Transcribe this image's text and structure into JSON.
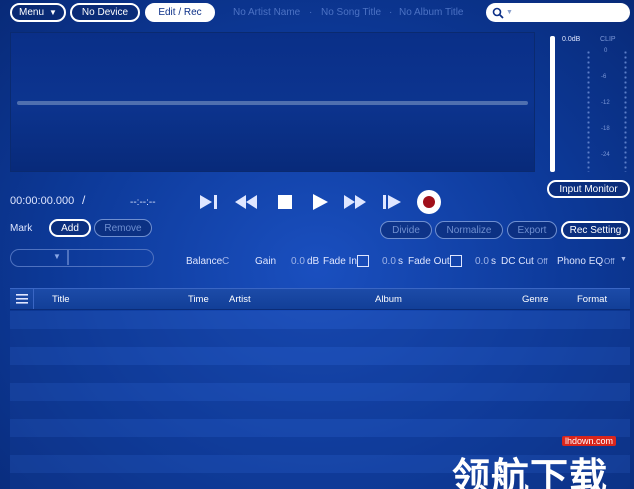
{
  "toolbar": {
    "menu_label": "Menu",
    "device_label": "No Device",
    "edit_rec_label": "Edit / Rec",
    "artist_placeholder": "No Artist Name",
    "song_placeholder": "No Song Title",
    "album_placeholder": "No Album Title"
  },
  "meter": {
    "db_label": "0.0dB",
    "clip_label": "CLIP",
    "scale": [
      "0",
      "-6",
      "-12",
      "-18",
      "-24"
    ],
    "input_monitor_label": "Input Monitor"
  },
  "time": {
    "position": "00:00:00.000",
    "separator": "/",
    "length": "--:--:--"
  },
  "mark": {
    "label": "Mark",
    "add_label": "Add",
    "remove_label": "Remove"
  },
  "actions": {
    "divide_label": "Divide",
    "normalize_label": "Normalize",
    "export_label": "Export",
    "rec_setting_label": "Rec Setting"
  },
  "controls": {
    "balance_label": "Balance",
    "balance_value": "C",
    "gain_label": "Gain",
    "gain_value": "0.0",
    "gain_unit": "dB",
    "fade_in_label": "Fade In",
    "fade_in_value": "0.0",
    "fade_in_unit": "s",
    "fade_out_label": "Fade Out",
    "fade_out_value": "0.0",
    "fade_out_unit": "s",
    "dc_cut_label": "DC Cut",
    "dc_cut_value": "Off",
    "phono_eq_label": "Phono EQ",
    "phono_eq_value": "Off"
  },
  "table": {
    "columns": [
      "Title",
      "Time",
      "Artist",
      "Album",
      "Genre",
      "Format"
    ]
  },
  "watermark": {
    "text": "领航下载",
    "url": "lhdown.com"
  },
  "colors": {
    "background": "#0d3a9a",
    "record": "#a0101a",
    "accent": "#ffffff"
  }
}
